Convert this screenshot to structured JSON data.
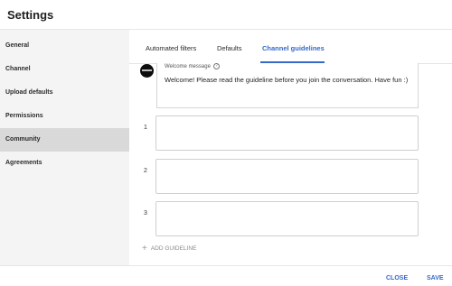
{
  "window": {
    "title": "Settings"
  },
  "sidebar": {
    "items": [
      {
        "label": "General"
      },
      {
        "label": "Channel"
      },
      {
        "label": "Upload defaults"
      },
      {
        "label": "Permissions"
      },
      {
        "label": "Community",
        "active": true
      },
      {
        "label": "Agreements"
      }
    ]
  },
  "tabs": [
    {
      "label": "Automated filters"
    },
    {
      "label": "Defaults"
    },
    {
      "label": "Channel guidelines",
      "active": true
    }
  ],
  "welcome": {
    "label": "Welcome message",
    "text": "Welcome! Please read the guideline before you join the conversation. Have fun :)"
  },
  "guidelines": [
    {
      "number": "1",
      "value": ""
    },
    {
      "number": "2",
      "value": ""
    },
    {
      "number": "3",
      "value": ""
    }
  ],
  "add_guideline": {
    "label": "ADD GUIDELINE"
  },
  "footer": {
    "close_label": "CLOSE",
    "save_label": "SAVE"
  },
  "colors": {
    "accent": "#3469c8",
    "sidebar_bg": "#f4f4f4",
    "active_nav_bg": "#d9d9d9"
  }
}
